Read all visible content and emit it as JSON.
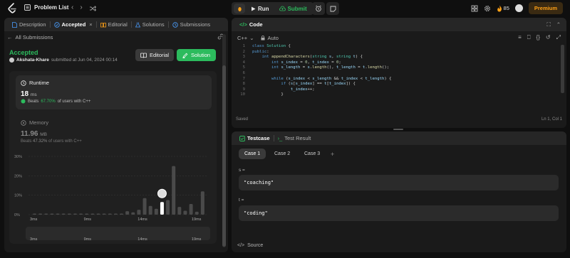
{
  "topbar": {
    "title": "Problem List",
    "run_label": "Run",
    "submit_label": "Submit",
    "streak": "85",
    "premium_label": "Premium"
  },
  "left_tabs": [
    {
      "label": "Description",
      "icon": "file-icon"
    },
    {
      "label": "Accepted",
      "icon": "accepted-icon",
      "active": true
    },
    {
      "label": "Editorial",
      "icon": "book-icon"
    },
    {
      "label": "Solutions",
      "icon": "flask-icon"
    },
    {
      "label": "Submissions",
      "icon": "history-icon"
    }
  ],
  "submission": {
    "back_label": "All Submissions",
    "status": "Accepted",
    "user": "Akshata-Khare",
    "submitted_text": "submitted at Jun 04, 2024 00:14",
    "editorial_label": "Editorial",
    "solution_label": "Solution"
  },
  "runtime": {
    "title": "Runtime",
    "value": "18",
    "unit": "ms",
    "beats_prefix": "Beats",
    "beats_pct": "67.70%",
    "beats_suffix": "of users with C++"
  },
  "memory": {
    "title": "Memory",
    "value": "11.96",
    "unit": "MB",
    "beats_prefix": "Beats",
    "beats_pct": "47.32%",
    "beats_suffix": "of users with C++"
  },
  "chart_data": {
    "type": "bar",
    "yticks": [
      "30%",
      "20%",
      "10%",
      "0%"
    ],
    "ylim": [
      0,
      30
    ],
    "xticks": [
      "3ms",
      "9ms",
      "14ms",
      "19ms"
    ],
    "values": [
      0.3,
      0.3,
      0.3,
      0.5,
      0.3,
      0.3,
      0.5,
      0.3,
      0.3,
      0.4,
      0.3,
      0.3,
      0.4,
      0.5,
      0.4,
      0.3,
      1.8,
      1.2,
      2.5,
      8.5,
      4.5,
      3.0,
      6.5,
      7.5,
      25.0,
      4.0,
      2.0,
      5.5,
      1.5,
      12.0
    ],
    "highlight_index": 22,
    "overview_xticks": [
      "3ms",
      "9ms",
      "14ms",
      "19ms"
    ]
  },
  "editor": {
    "title": "Code",
    "language": "C++",
    "mode": "Auto",
    "status_left": "Saved",
    "status_right": "Ln 1, Col 1",
    "lines": [
      {
        "n": "1",
        "html": "<span class='kw'>class</span> <span class='ty'>Solution</span> <span class='pl'>{</span>"
      },
      {
        "n": "2",
        "html": "<span class='kw'>public</span><span class='pl'>:</span>"
      },
      {
        "n": "3",
        "html": "    <span class='kw'>int</span> <span class='fn'>appendCharacters</span><span class='pl'>(</span><span class='ty'>string</span> <span class='id'>s</span><span class='pl'>,</span> <span class='ty'>string</span> <span class='id'>t</span><span class='pl'>) {</span>"
      },
      {
        "n": "4",
        "html": "        <span class='kw'>int</span> <span class='id'>s_index</span> <span class='pl'>=</span> <span class='nu'>0</span><span class='pl'>,</span> <span class='id'>t_index</span> <span class='pl'>=</span> <span class='nu'>0</span><span class='pl'>;</span>"
      },
      {
        "n": "5",
        "html": "        <span class='kw'>int</span> <span class='id'>s_length</span> <span class='pl'>=</span> <span class='id'>s</span><span class='pl'>.</span><span class='fn'>length</span><span class='pl'>(),</span> <span class='id'>t_length</span> <span class='pl'>=</span> <span class='id'>t</span><span class='pl'>.</span><span class='fn'>length</span><span class='pl'>();</span>"
      },
      {
        "n": "6",
        "html": ""
      },
      {
        "n": "7",
        "html": "        <span class='kw'>while</span> <span class='pl'>(</span><span class='id'>s_index</span> <span class='pl'>&lt;</span> <span class='id'>s_length</span> <span class='pl'>&amp;&amp;</span> <span class='id'>t_index</span> <span class='pl'>&lt;</span> <span class='id'>t_length</span><span class='pl'>) {</span>"
      },
      {
        "n": "8",
        "html": "            <span class='kw'>if</span> <span class='pl'>(</span><span class='id'>s</span><span class='pl'>[</span><span class='id'>s_index</span><span class='pl'>] ==</span> <span class='id'>t</span><span class='pl'>[</span><span class='id'>t_index</span><span class='pl'>]) {</span>"
      },
      {
        "n": "9",
        "html": "                <span class='id'>t_index</span><span class='pl'>++;</span>"
      },
      {
        "n": "10",
        "html": "            <span class='pl'>}</span>"
      }
    ]
  },
  "testpanel": {
    "testcase_label": "Testcase",
    "result_label": "Test Result",
    "cases": [
      "Case 1",
      "Case 2",
      "Case 3"
    ],
    "add_label": "+",
    "s_label": "s =",
    "s_value": "\"coaching\"",
    "t_label": "t =",
    "t_value": "\"coding\"",
    "source_label": "Source"
  },
  "colors": {
    "accent_green": "#2cbb5d",
    "accent_orange": "#ffa116",
    "panel": "#1a1a1a",
    "tabbar": "#262626"
  }
}
